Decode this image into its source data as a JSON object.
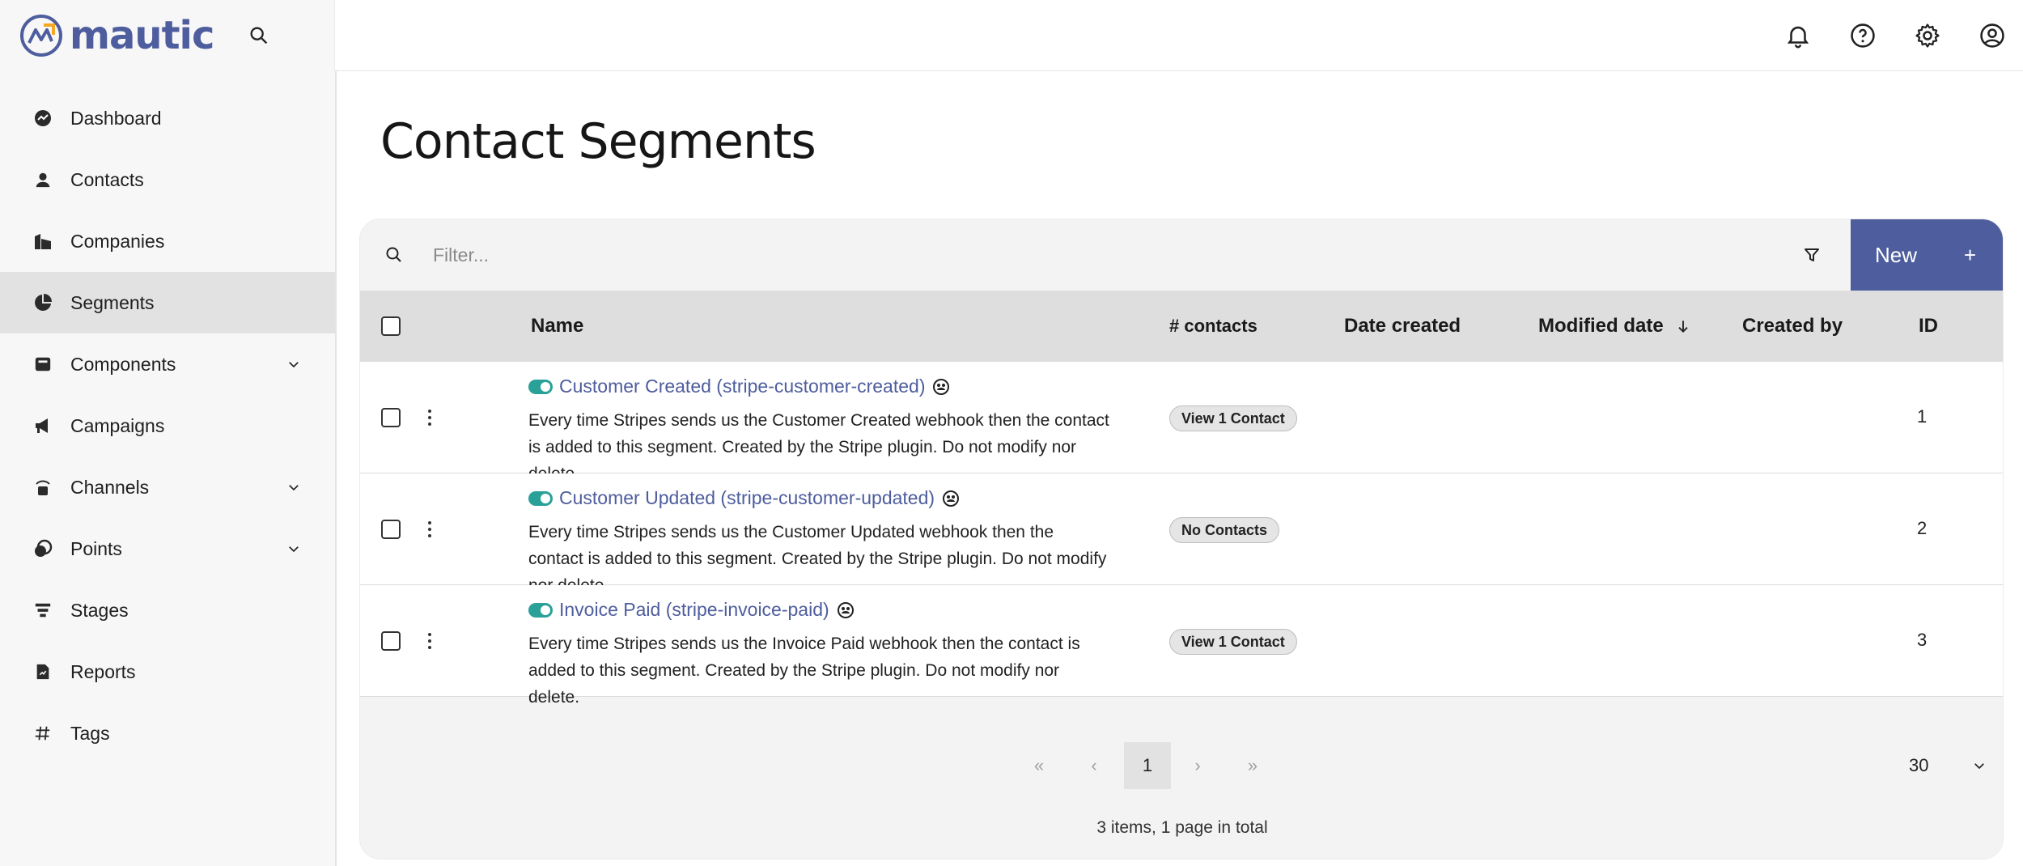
{
  "brand": {
    "name": "mautic"
  },
  "header": {
    "icons": [
      "search-icon",
      "bell-icon",
      "help-icon",
      "gear-icon",
      "user-icon"
    ]
  },
  "sidebar": {
    "items": [
      {
        "label": "Dashboard",
        "icon": "dashboard-icon"
      },
      {
        "label": "Contacts",
        "icon": "contacts-icon"
      },
      {
        "label": "Companies",
        "icon": "companies-icon"
      },
      {
        "label": "Segments",
        "icon": "segments-icon",
        "active": true
      },
      {
        "label": "Components",
        "icon": "components-icon",
        "expandable": true
      },
      {
        "label": "Campaigns",
        "icon": "campaigns-icon"
      },
      {
        "label": "Channels",
        "icon": "channels-icon",
        "expandable": true
      },
      {
        "label": "Points",
        "icon": "points-icon",
        "expandable": true
      },
      {
        "label": "Stages",
        "icon": "stages-icon"
      },
      {
        "label": "Reports",
        "icon": "reports-icon"
      },
      {
        "label": "Tags",
        "icon": "tags-icon"
      }
    ]
  },
  "page": {
    "title": "Contact Segments"
  },
  "toolbar": {
    "filter_placeholder": "Filter...",
    "new_label": "New",
    "new_plus": "+"
  },
  "table": {
    "columns": {
      "name": "Name",
      "contacts": "# contacts",
      "date_created": "Date created",
      "modified_date": "Modified date",
      "created_by": "Created by",
      "id": "ID"
    },
    "rows": [
      {
        "name": "Customer Created (stripe-customer-created)",
        "description": "Every time Stripes sends us the Customer Created webhook then the contact is added to this segment. Created by the Stripe plugin. Do not modify nor delete.",
        "contacts_badge": "View 1 Contact",
        "id": "1"
      },
      {
        "name": "Customer Updated (stripe-customer-updated)",
        "description": "Every time Stripes sends us the Customer Updated webhook then the contact is added to this segment. Created by the Stripe plugin. Do not modify nor delete.",
        "contacts_badge": "No Contacts",
        "id": "2"
      },
      {
        "name": "Invoice Paid (stripe-invoice-paid)",
        "description": "Every time Stripes sends us the Invoice Paid webhook then the contact is added to this segment. Created by the Stripe plugin. Do not modify nor delete.",
        "contacts_badge": "View 1 Contact",
        "id": "3"
      }
    ]
  },
  "pagination": {
    "first": "«",
    "prev": "‹",
    "current_page": "1",
    "next": "›",
    "last": "»",
    "per_page": "30",
    "summary": "3 items, 1 page in total"
  },
  "colors": {
    "brand": "#4e5d9d",
    "toggle_on": "#2aa198",
    "sidebar_bg": "#f7f7f7",
    "active_bg": "#e2e2e2"
  }
}
